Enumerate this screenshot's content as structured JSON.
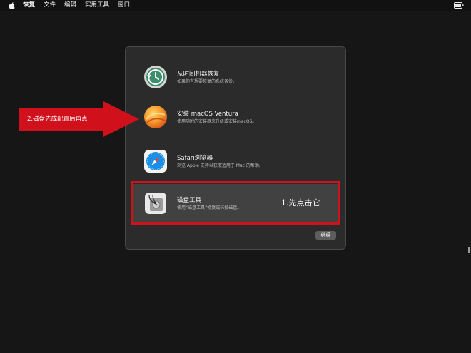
{
  "menubar": {
    "items": [
      "恢复",
      "文件",
      "编辑",
      "实用工具",
      "窗口"
    ]
  },
  "options": [
    {
      "title": "从时间机器恢复",
      "desc": "如果你有想要恢复的系统备份。",
      "icon": "time-machine-icon"
    },
    {
      "title": "安装 macOS Ventura",
      "desc": "使用随附的安装器来升级或安装macOS。",
      "icon": "macos-ventura-icon"
    },
    {
      "title": "Safari浏览器",
      "desc": "浏览 Apple 支持以获取适用于 Mac 的帮助。",
      "icon": "safari-icon"
    },
    {
      "title": "磁盘工具",
      "desc": "使用“磁盘工具”修复或抹掉磁盘。",
      "icon": "disk-utility-icon"
    }
  ],
  "continue_label": "继续",
  "annotations": {
    "step1": "1.先点击它",
    "step2": "2.磁盘先成配置后再点"
  },
  "colors": {
    "annotation_red": "#d0101a",
    "window_bg": "#2b2b2b",
    "selected_bg": "#414141"
  }
}
